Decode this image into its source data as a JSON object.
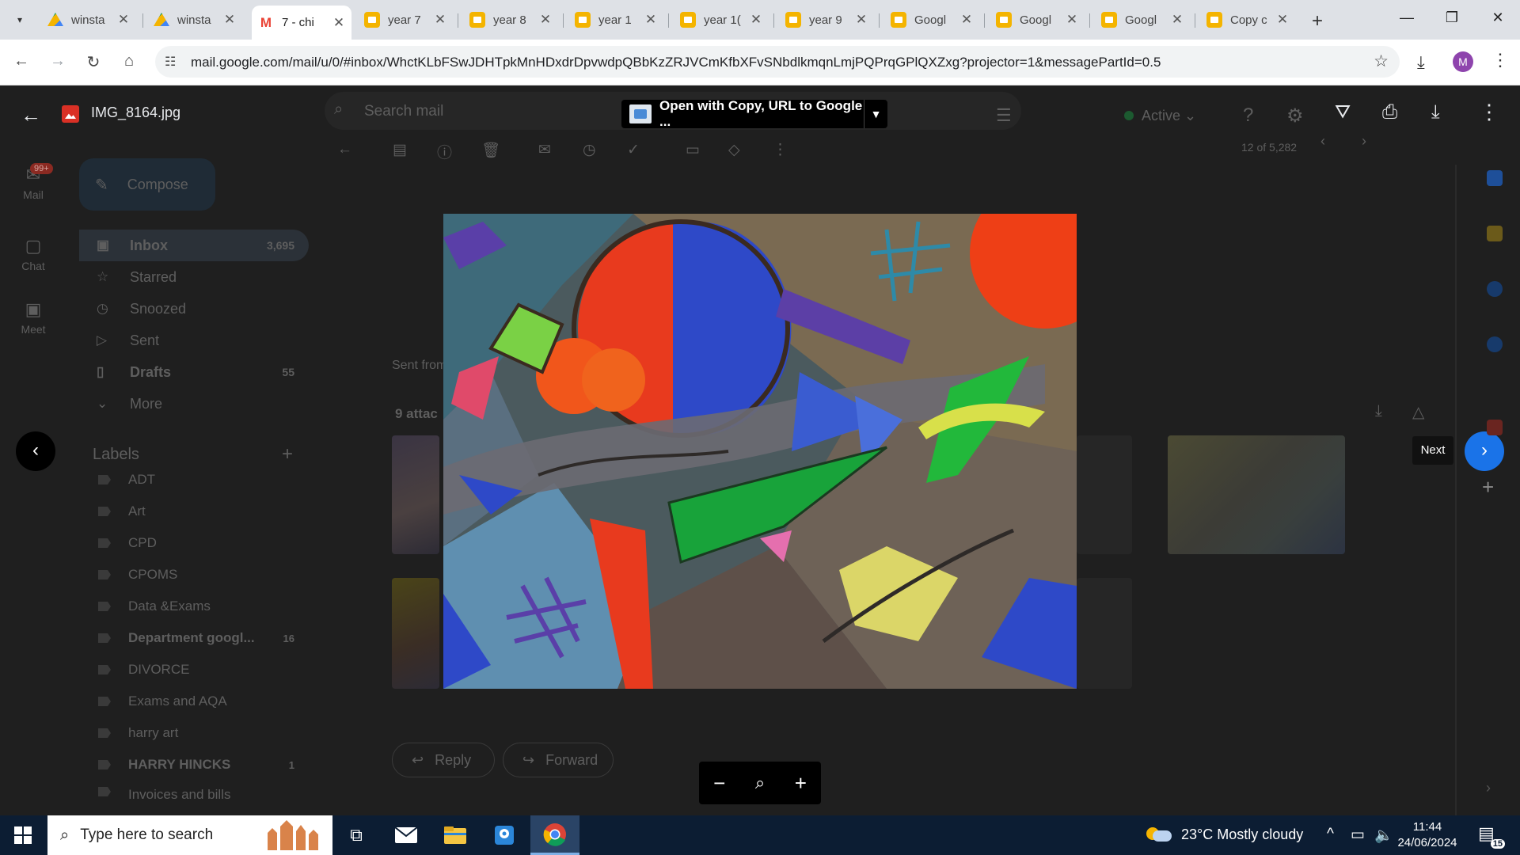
{
  "browser": {
    "tabs": [
      {
        "title": "winsta",
        "icon": "drive-icon"
      },
      {
        "title": "winsta",
        "icon": "drive-icon"
      },
      {
        "title": "7 - chi",
        "icon": "gmail-icon",
        "active": true
      },
      {
        "title": "year 7",
        "icon": "slides-icon"
      },
      {
        "title": "year 8",
        "icon": "slides-icon"
      },
      {
        "title": "year 1",
        "icon": "slides-icon"
      },
      {
        "title": "year 1(",
        "icon": "slides-icon"
      },
      {
        "title": "year 9",
        "icon": "slides-icon"
      },
      {
        "title": "Googl",
        "icon": "slides-icon"
      },
      {
        "title": "Googl",
        "icon": "slides-icon"
      },
      {
        "title": "Googl",
        "icon": "slides-icon"
      },
      {
        "title": "Copy c",
        "icon": "slides-icon"
      }
    ],
    "url": "mail.google.com/mail/u/0/#inbox/WhctKLbFSwJDHTpkMnHDxdrDpvwdpQBbKzZRJVCmKfbXFvSNbdlkmqnLmjPQPrqGPlQXZxg?projector=1&messagePartId=0.5",
    "profile_initial": "M",
    "accent": "#1a73e8"
  },
  "viewer": {
    "filename": "IMG_8164.jpg",
    "open_with_label": "Open with Copy, URL to Google ...",
    "next_label": "Next"
  },
  "gmail": {
    "search_placeholder": "Search mail",
    "status": "Active",
    "rail": [
      {
        "label": "Mail",
        "icon": "mail-icon",
        "badge": "99+"
      },
      {
        "label": "Chat",
        "icon": "chat-icon"
      },
      {
        "label": "Meet",
        "icon": "meet-icon"
      }
    ],
    "compose_label": "Compose",
    "folders": [
      {
        "label": "Inbox",
        "count": "3,695",
        "icon": "inbox-icon"
      },
      {
        "label": "Starred",
        "count": "",
        "icon": "star-icon"
      },
      {
        "label": "Snoozed",
        "count": "",
        "icon": "clock-icon"
      },
      {
        "label": "Sent",
        "count": "",
        "icon": "send-icon"
      },
      {
        "label": "Drafts",
        "count": "55",
        "icon": "draft-icon"
      },
      {
        "label": "More",
        "count": "",
        "icon": "chevron-down-icon"
      }
    ],
    "labels_title": "Labels",
    "labels": [
      {
        "name": "ADT",
        "count": ""
      },
      {
        "name": "Art",
        "count": ""
      },
      {
        "name": "CPD",
        "count": ""
      },
      {
        "name": "CPOMS",
        "count": ""
      },
      {
        "name": "Data &Exams",
        "count": ""
      },
      {
        "name": "Department googl...",
        "count": "16"
      },
      {
        "name": "DIVORCE",
        "count": ""
      },
      {
        "name": "Exams and AQA",
        "count": ""
      },
      {
        "name": "harry art",
        "count": ""
      },
      {
        "name": "HARRY HINCKS",
        "count": "1"
      },
      {
        "name": "Invoices and bills",
        "count": ""
      }
    ],
    "page_count": "12 of 5,282",
    "sent_from": "Sent from",
    "attachments": "9 attac",
    "reply_label": "Reply",
    "forward_label": "Forward"
  },
  "taskbar": {
    "search_placeholder": "Type here to search",
    "weather": "23°C  Mostly cloudy",
    "time": "11:44",
    "date": "24/06/2024",
    "notifications": "15"
  }
}
